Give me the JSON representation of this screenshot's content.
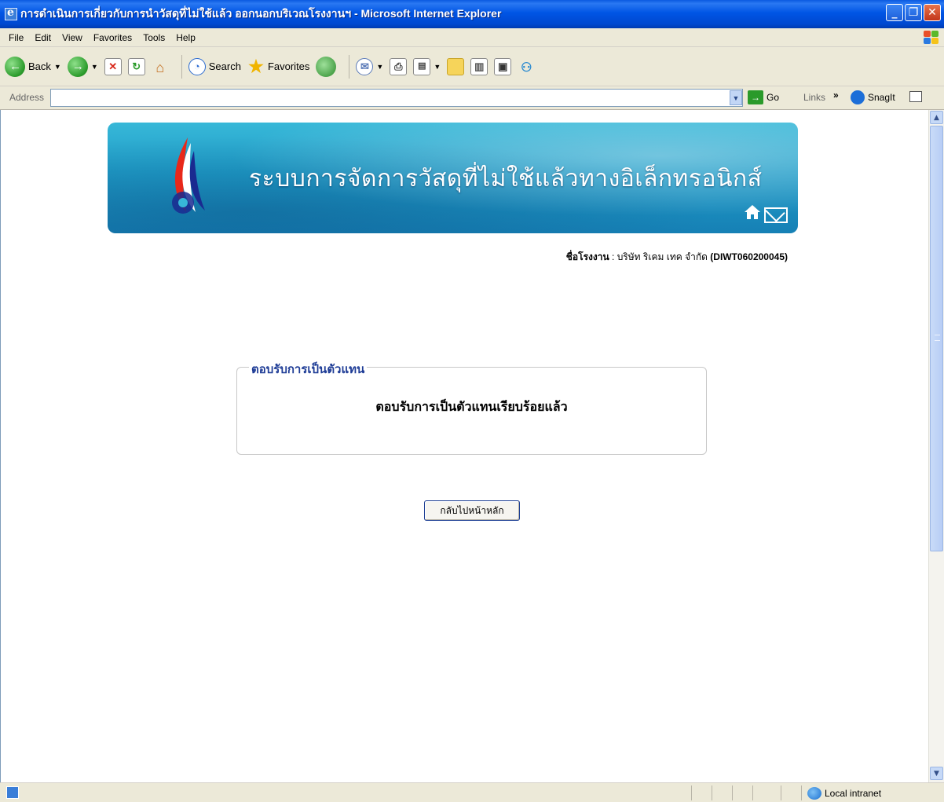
{
  "window": {
    "title": "การดำเนินการเกี่ยวกับการนำวัสดุที่ไม่ใช้แล้ว ออกนอกบริเวณโรงงานฯ - Microsoft Internet Explorer",
    "minimize": "_",
    "restore": "❐",
    "close": "✕"
  },
  "menu": [
    "File",
    "Edit",
    "View",
    "Favorites",
    "Tools",
    "Help"
  ],
  "toolbar": {
    "back_label": "Back",
    "search_label": "Search",
    "favorites_label": "Favorites"
  },
  "address": {
    "label": "Address",
    "value": "",
    "go_label": "Go",
    "links_label": "Links",
    "snagit_label": "SnagIt"
  },
  "banner": {
    "title": "ระบบการจัดการวัสดุที่ไม่ใช้แล้วทางอิเล็กทรอนิกส์"
  },
  "factory": {
    "label": "ชื่อโรงงาน",
    "separator": " : ",
    "name": "บริษัท ริเคม เทค จำกัด",
    "code": "(DIWT060200045)"
  },
  "result_box": {
    "legend": "ตอบรับการเป็นตัวแทน",
    "message": "ตอบรับการเป็นตัวแทนเรียบร้อยแล้ว"
  },
  "back_button_label": "กลับไปหน้าหลัก",
  "status": {
    "zone": "Local intranet"
  },
  "icons": {
    "back": "back-arrow-icon",
    "forward": "forward-arrow-icon",
    "stop": "stop-icon",
    "refresh": "refresh-icon",
    "home": "home-icon",
    "search": "search-icon",
    "favorites": "star-icon",
    "history": "history-icon",
    "mail": "mail-icon",
    "print": "print-icon"
  },
  "colors": {
    "titlebar": "#0055e5",
    "legend_text": "#1e3c96",
    "banner": "#1f9cc8"
  }
}
